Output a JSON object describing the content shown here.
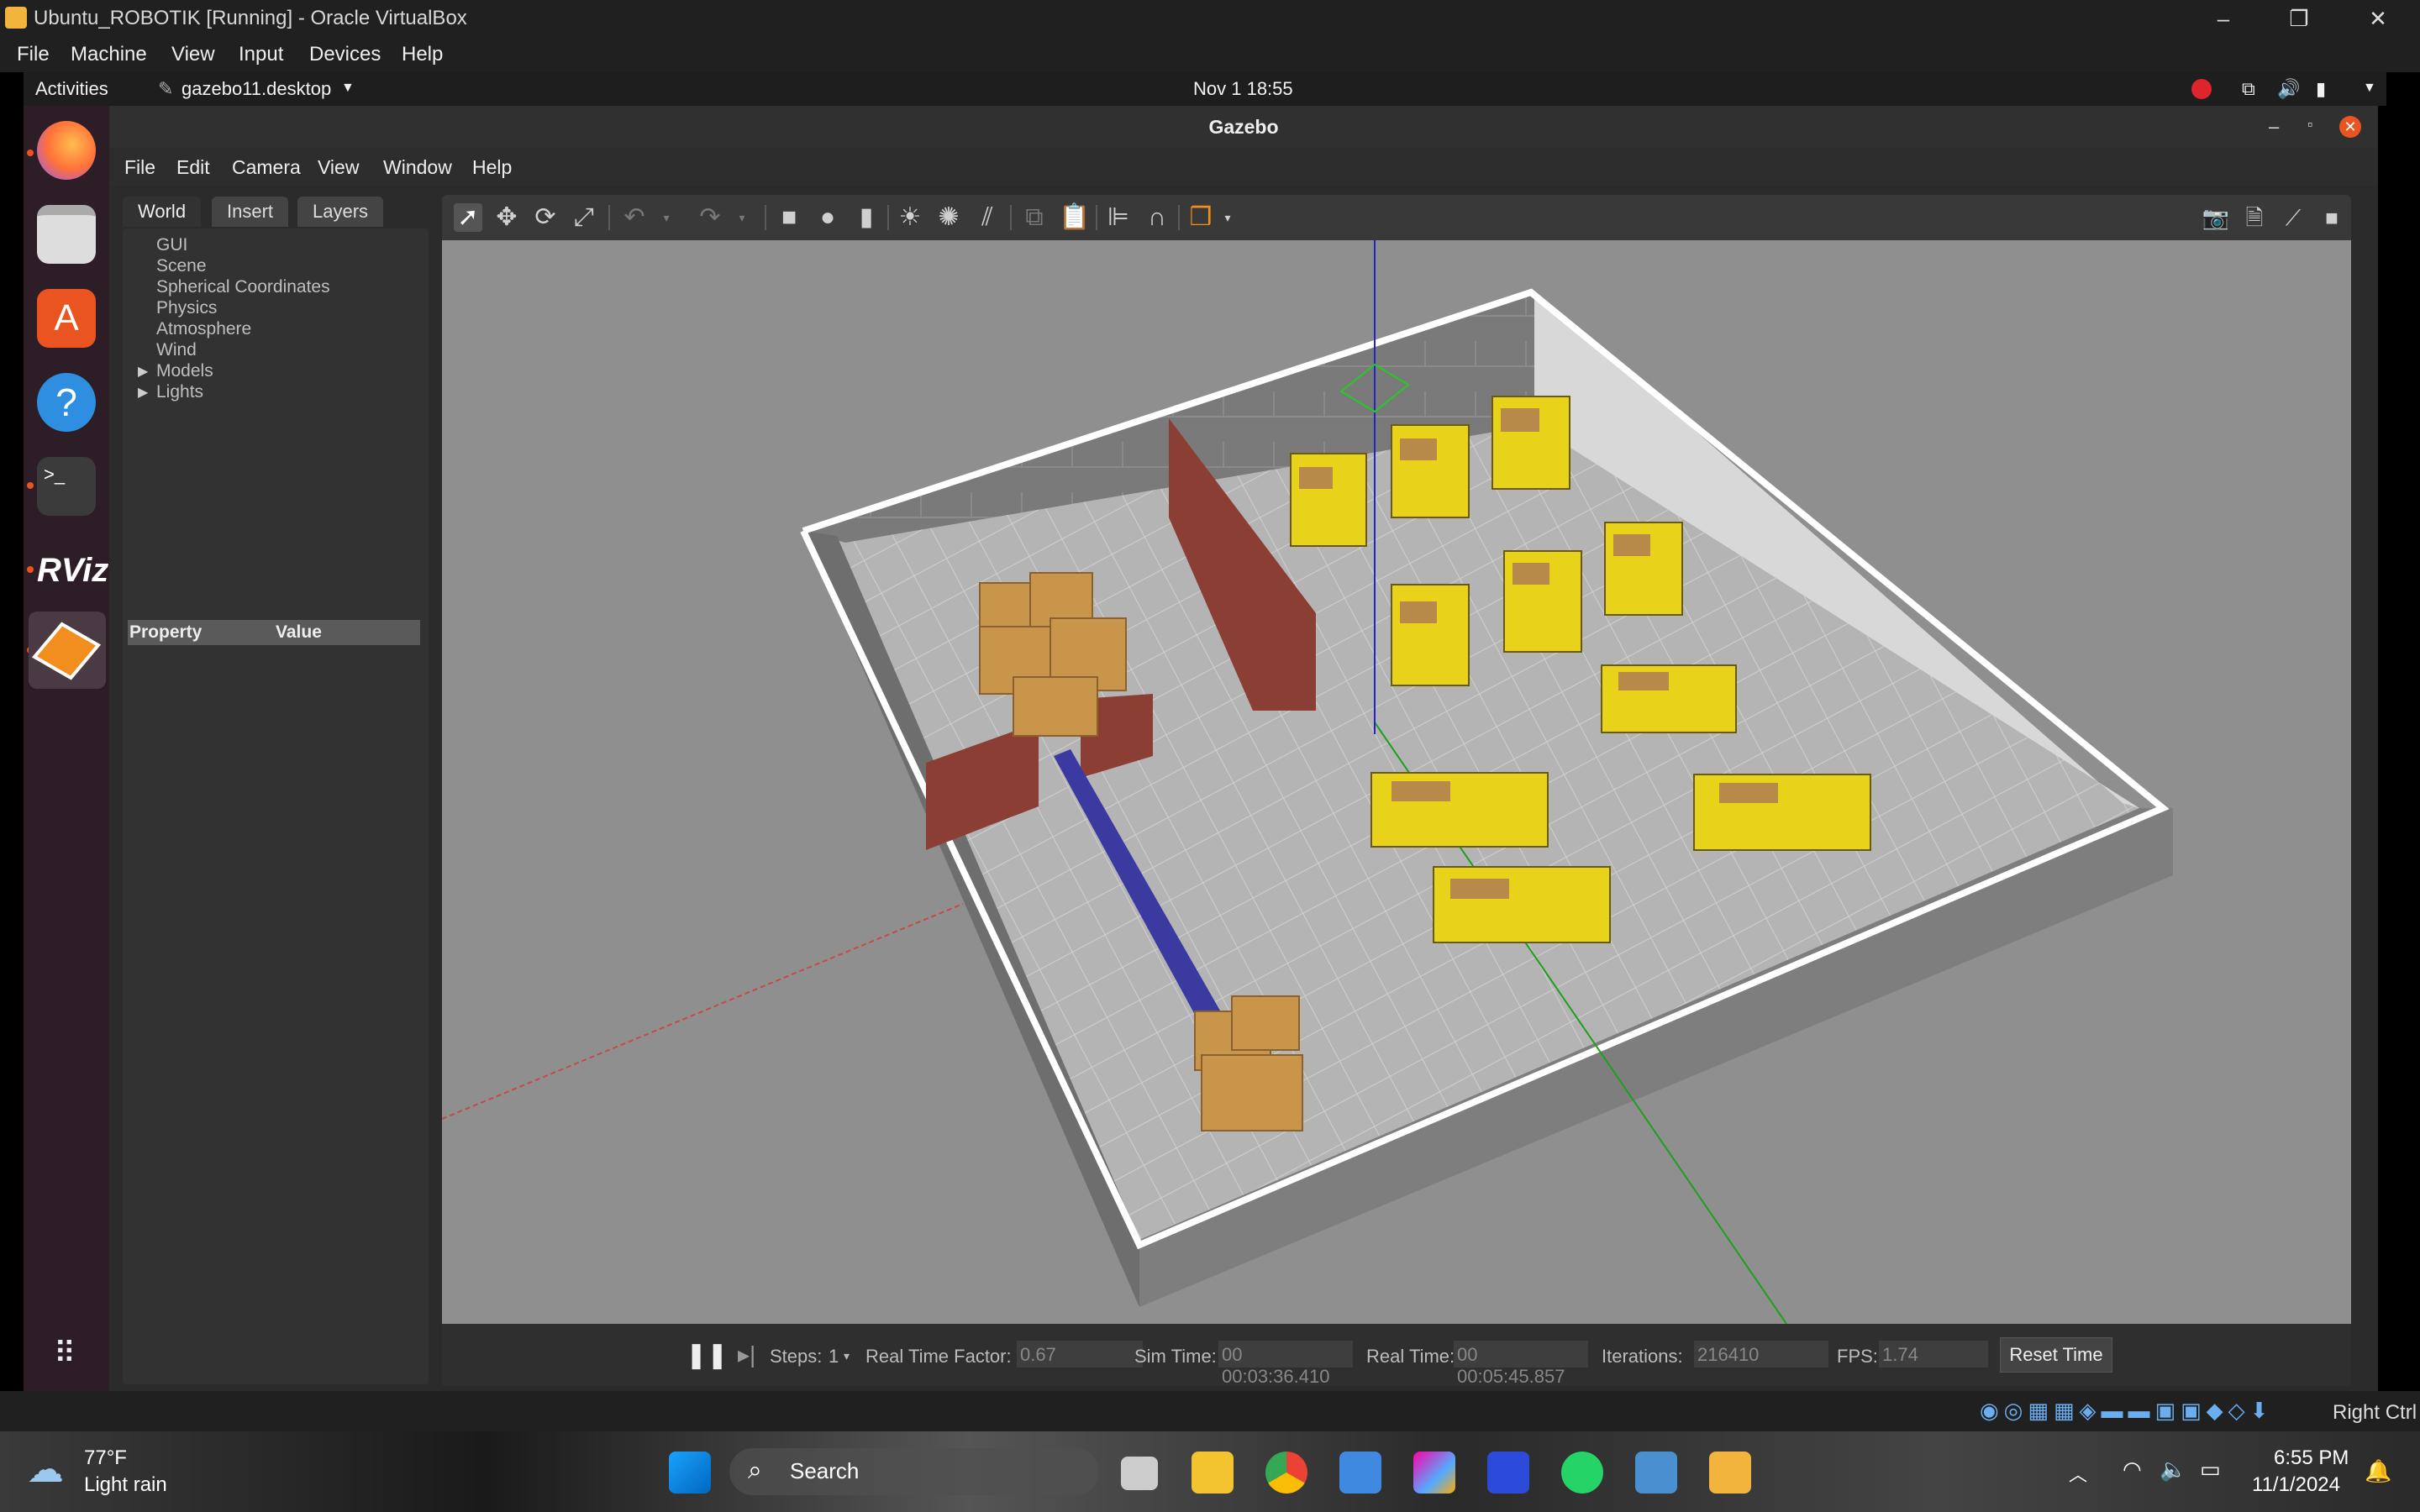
{
  "vbox": {
    "title": "Ubuntu_ROBOTIK [Running] - Oracle VirtualBox",
    "menu": [
      "File",
      "Machine",
      "View",
      "Input",
      "Devices",
      "Help"
    ],
    "host_key": "Right Ctrl"
  },
  "ubuntu": {
    "activities": "Activities",
    "app_name": "gazebo11.desktop",
    "clock": "Nov 1  18:55"
  },
  "gazebo": {
    "title": "Gazebo",
    "menu": [
      "File",
      "Edit",
      "Camera",
      "View",
      "Window",
      "Help"
    ],
    "tabs": [
      "World",
      "Insert",
      "Layers"
    ],
    "tree": [
      "GUI",
      "Scene",
      "Spherical Coordinates",
      "Physics",
      "Atmosphere",
      "Wind",
      "Models",
      "Lights"
    ],
    "props": {
      "property": "Property",
      "value": "Value"
    },
    "status": {
      "steps_label": "Steps:",
      "steps_value": "1",
      "rtf_label": "Real Time Factor:",
      "rtf_value": "0.67",
      "sim_label": "Sim Time:",
      "sim_value": "00 00:03:36.410",
      "real_label": "Real Time:",
      "real_value": "00 00:05:45.857",
      "iter_label": "Iterations:",
      "iter_value": "216410",
      "fps_label": "FPS:",
      "fps_value": "1.74",
      "reset": "Reset Time"
    }
  },
  "windows": {
    "weather_temp": "77°F",
    "weather_desc": "Light rain",
    "search": "Search",
    "time": "6:55 PM",
    "date": "11/1/2024"
  },
  "colors": {
    "ubuntu_orange": "#e95420",
    "shelf_yellow": "#e8d21a",
    "box_brown": "#c8954a",
    "brick": "#8b3e33"
  }
}
